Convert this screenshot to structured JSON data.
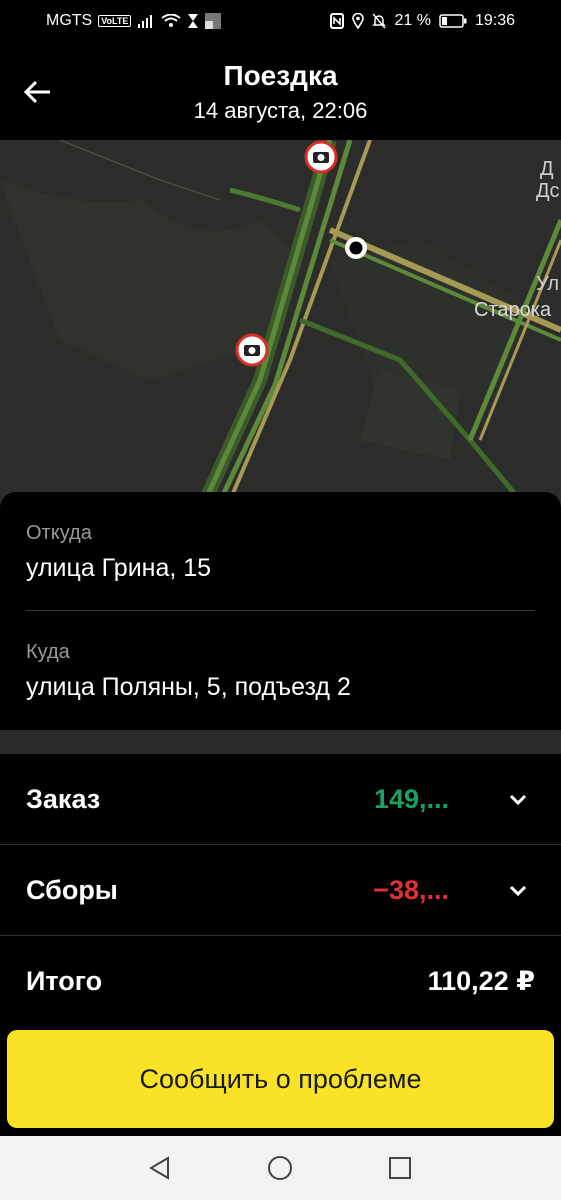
{
  "status_bar": {
    "carrier": "MGTS",
    "volte": "VoLTE",
    "battery": "21 %",
    "time": "19:36"
  },
  "header": {
    "title": "Поездка",
    "subtitle": "14 августа, 22:06"
  },
  "map": {
    "labels": [
      "Д",
      "Дс",
      "Ул",
      "Старока"
    ]
  },
  "route": {
    "from_label": "Откуда",
    "from_value": "улица Грина, 15",
    "to_label": "Куда",
    "to_value": "улица Поляны, 5, подъезд 2"
  },
  "payment": {
    "order_label": "Заказ",
    "order_amount": "149,...",
    "fees_label": "Сборы",
    "fees_amount": "−38,...",
    "total_label": "Итого",
    "total_amount": "110,22 ₽"
  },
  "actions": {
    "report_label": "Сообщить о проблеме"
  },
  "colors": {
    "accent_yellow": "#fae227",
    "positive_green": "#1aa160",
    "negative_red": "#e0303a"
  }
}
